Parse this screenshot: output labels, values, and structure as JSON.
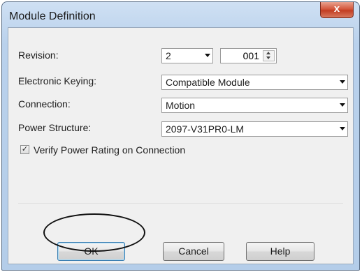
{
  "window": {
    "title": "Module Definition",
    "close_label": "x"
  },
  "form": {
    "revision": {
      "label": "Revision:",
      "major": "2",
      "minor": "001"
    },
    "electronic_keying": {
      "label": "Electronic Keying:",
      "value": "Compatible Module"
    },
    "connection": {
      "label": "Connection:",
      "value": "Motion"
    },
    "power_structure": {
      "label": "Power Structure:",
      "value": "2097-V31PR0-LM"
    },
    "verify_power": {
      "label": "Verify Power Rating on Connection",
      "checked": true,
      "mark": "✓"
    }
  },
  "buttons": {
    "ok": "OK",
    "cancel": "Cancel",
    "help": "Help"
  }
}
